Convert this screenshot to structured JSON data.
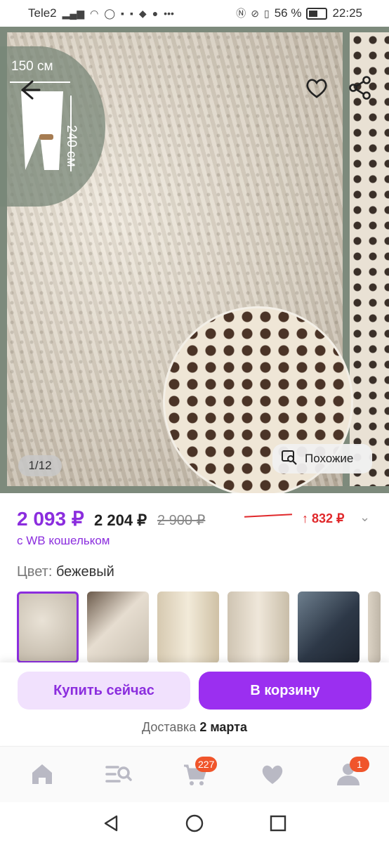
{
  "status_bar": {
    "carrier": "Tele2",
    "battery_pct": "56 %",
    "time": "22:25"
  },
  "hero": {
    "size_width": "150 см",
    "size_height": "240 см",
    "page_indicator": "1/12",
    "similar_label": "Похожие"
  },
  "price": {
    "main": "2 093 ₽",
    "secondary": "2 204 ₽",
    "old": "2 900 ₽",
    "increase": "832 ₽",
    "wallet_label": "с WB кошельком"
  },
  "color": {
    "label": "Цвет:",
    "value": "бежевый"
  },
  "actions": {
    "buy_now": "Купить сейчас",
    "add_to_cart": "В корзину",
    "delivery_label": "Доставка",
    "delivery_date": "2 марта"
  },
  "bottom_nav": {
    "cart_badge": "227",
    "profile_badge": "1"
  },
  "colors": {
    "accent": "#8b2dde",
    "accent_bright": "#9b2ff0",
    "red": "#e0282b",
    "badge": "#f0552b"
  }
}
